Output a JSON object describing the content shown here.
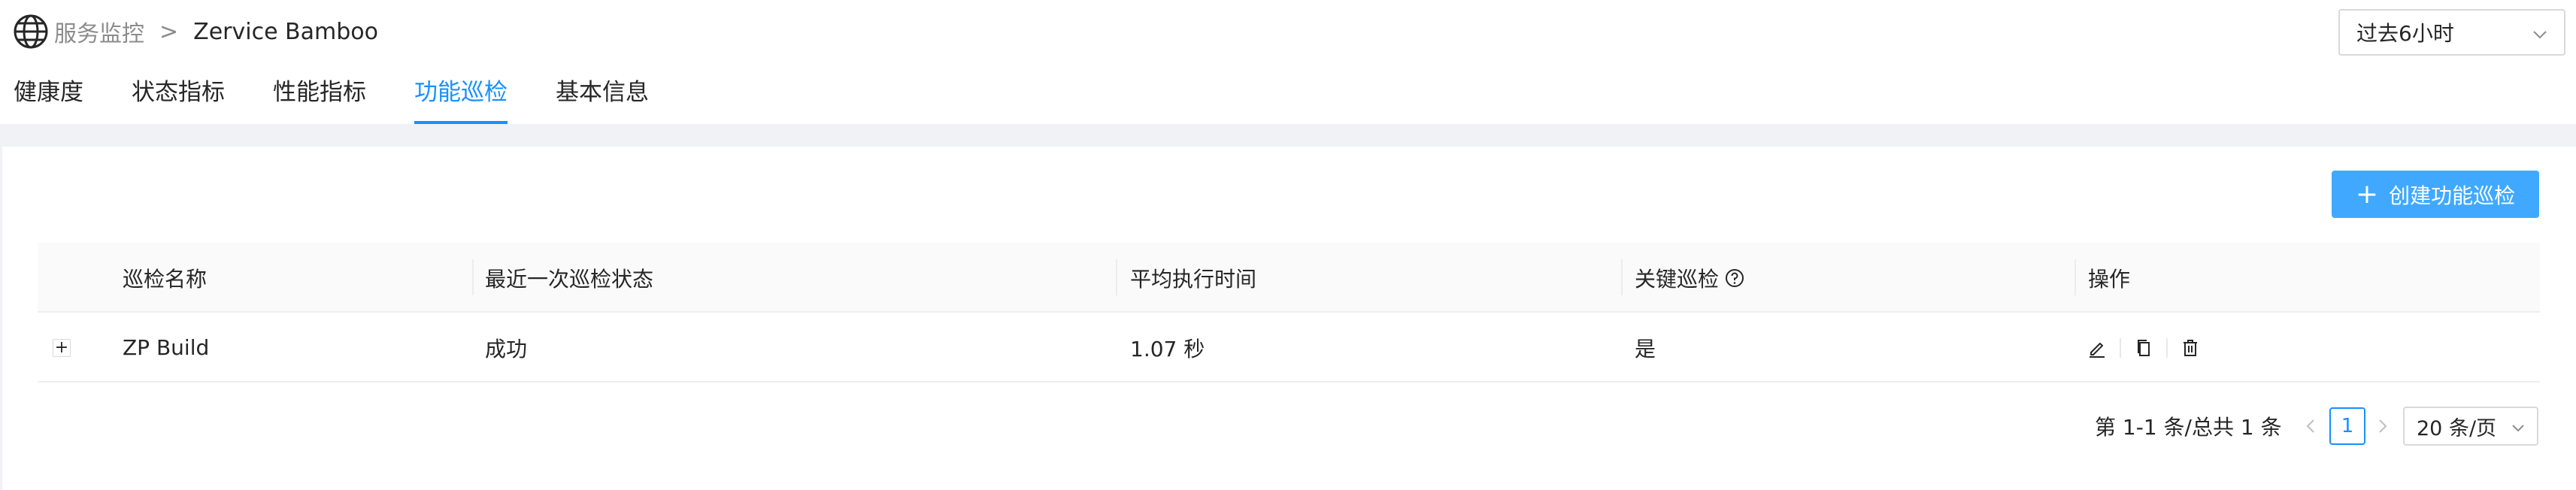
{
  "breadcrumb": {
    "root": "服务监控",
    "separator": ">",
    "current": "Zervice Bamboo"
  },
  "time_range": {
    "selected": "过去6小时"
  },
  "tabs": [
    {
      "label": "健康度",
      "active": false
    },
    {
      "label": "状态指标",
      "active": false
    },
    {
      "label": "性能指标",
      "active": false
    },
    {
      "label": "功能巡检",
      "active": true
    },
    {
      "label": "基本信息",
      "active": false
    }
  ],
  "actions": {
    "create_label": "创建功能巡检"
  },
  "table": {
    "columns": [
      "巡检名称",
      "最近一次巡检状态",
      "平均执行时间",
      "关键巡检",
      "操作"
    ],
    "rows": [
      {
        "expand": "+",
        "name": "ZP Build",
        "status": "成功",
        "avg_time": "1.07 秒",
        "critical": "是"
      }
    ]
  },
  "pagination": {
    "total_text": "第 1-1 条/总共 1 条",
    "current_page": "1",
    "page_size": "20 条/页"
  },
  "colors": {
    "primary": "#1890ff",
    "button": "#40a9ff",
    "muted": "#8c8c8c",
    "background": "#f0f2f5"
  }
}
